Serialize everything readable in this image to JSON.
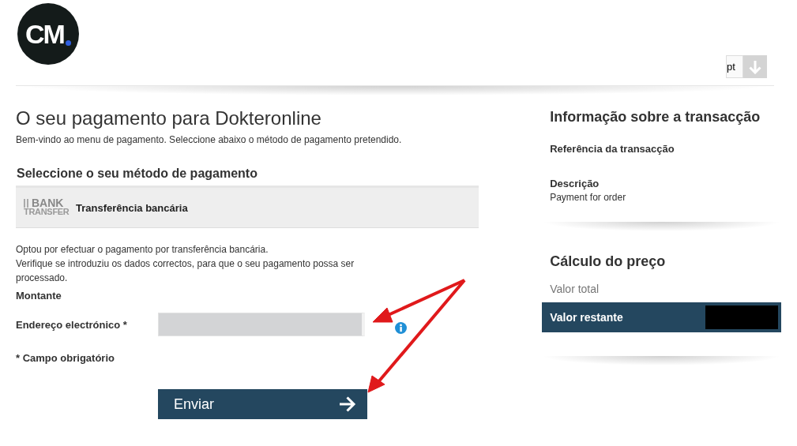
{
  "header": {
    "logo": "CM",
    "language": "pt"
  },
  "payment": {
    "title": "O seu pagamento para Dokteronline",
    "intro": "Bem-vindo ao menu de pagamento. Seleccione abaixo o método de pagamento pretendido.",
    "methods_heading": "Seleccione o seu método de pagamento",
    "methods": [
      {
        "logo_top": "BANK",
        "logo_bottom": "TRANSFER",
        "label": "Transferência bancária",
        "selected": true
      }
    ],
    "notice": [
      "Optou por efectuar o pagamento por transferência bancária.",
      "Verifique se introduziu os dados correctos, para que o seu pagamento possa ser processado."
    ],
    "amount_label": "Montante",
    "email_label": "Endereço electrónico *",
    "required_note": "* Campo obrigatório",
    "submit": "Enviar"
  },
  "transaction": {
    "title": "Informação sobre a transacção",
    "reference_label": "Referência da transacção",
    "description_label": "Descrição",
    "description": "Payment for order"
  },
  "price": {
    "title": "Cálculo do preço",
    "total_label": "Valor total",
    "remaining_label": "Valor restante"
  }
}
